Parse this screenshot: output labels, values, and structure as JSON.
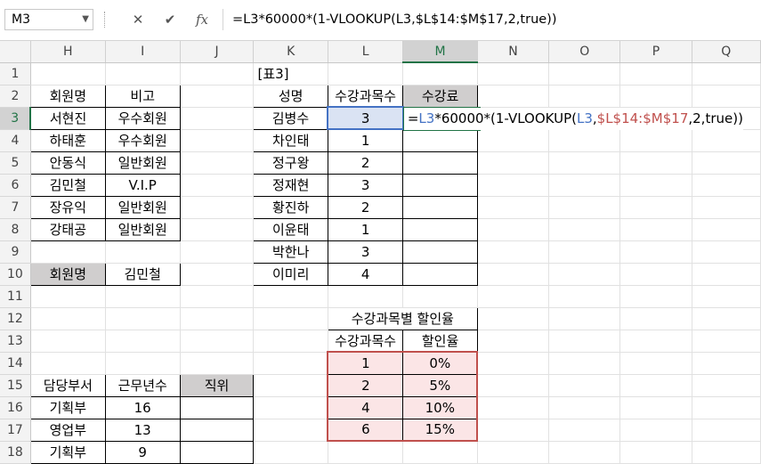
{
  "formula_bar": {
    "name_box": "M3",
    "cancel_icon": "✕",
    "enter_icon": "✔",
    "fx_label": "fx",
    "formula": "=L3*60000*(1-VLOOKUP(L3,$L$14:$M$17,2,true))"
  },
  "columns": [
    "H",
    "I",
    "J",
    "K",
    "L",
    "M",
    "N",
    "O",
    "P",
    "Q"
  ],
  "rows": [
    "1",
    "2",
    "3",
    "4",
    "5",
    "6",
    "7",
    "8",
    "9",
    "10",
    "11",
    "12",
    "13",
    "14",
    "15",
    "16",
    "17",
    "18"
  ],
  "member_table": {
    "header": [
      "회원명",
      "비고"
    ],
    "rows": [
      [
        "서현진",
        "우수회원"
      ],
      [
        "하태훈",
        "우수회원"
      ],
      [
        "안동식",
        "일반회원"
      ],
      [
        "김민철",
        "V.I.P"
      ],
      [
        "장유익",
        "일반회원"
      ],
      [
        "강태공",
        "일반회원"
      ]
    ]
  },
  "lookup": {
    "label": "회원명",
    "value": "김민철"
  },
  "table3": {
    "caption": "[표3]",
    "header": [
      "성명",
      "수강과목수",
      "수강료"
    ],
    "rows": [
      [
        "김병수",
        "3"
      ],
      [
        "차인태",
        "1"
      ],
      [
        "정구왕",
        "2"
      ],
      [
        "정재현",
        "3"
      ],
      [
        "황진하",
        "2"
      ],
      [
        "이윤태",
        "1"
      ],
      [
        "박한나",
        "3"
      ],
      [
        "이미리",
        "4"
      ]
    ]
  },
  "editing": {
    "part1": "=",
    "ref_l3": "L3",
    "part2": "*60000*(1-VLOOKUP(",
    "ref_l3b": "L3",
    "comma": ",",
    "ref_range": "$L$14:$M$17",
    "part3": ",2,true))"
  },
  "discount_table": {
    "title": "수강과목별 할인율",
    "header": [
      "수강과목수",
      "할인율"
    ],
    "rows": [
      [
        "1",
        "0%"
      ],
      [
        "2",
        "5%"
      ],
      [
        "4",
        "10%"
      ],
      [
        "6",
        "15%"
      ]
    ]
  },
  "dept_table": {
    "header": [
      "담당부서",
      "근무년수",
      "직위"
    ],
    "rows": [
      [
        "기획부",
        "16"
      ],
      [
        "영업부",
        "13"
      ],
      [
        "기획부",
        "9"
      ]
    ]
  },
  "colors": {
    "header_gray": "#d0cece",
    "selected_blue": "#dae3f3",
    "range_pink": "#fbe5e6",
    "range_red": "#c0504d",
    "ref_blue": "#4472c4",
    "excel_green": "#217346"
  }
}
